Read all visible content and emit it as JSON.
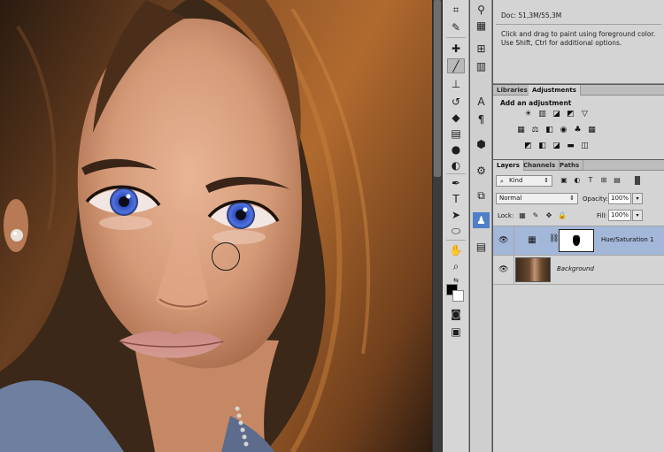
{
  "info": {
    "doc": "Doc: 51,3M/55,3M",
    "hint": "Click and drag to paint using foreground color.  Use Shift, Ctrl for additional options."
  },
  "adjustments_panel": {
    "tabs": [
      "Libraries",
      "Adjustments"
    ],
    "title": "Add an adjustment"
  },
  "layers_panel": {
    "tabs": [
      "Layers",
      "Channels",
      "Paths"
    ],
    "filter": "Kind",
    "blend_mode": "Normal",
    "opacity_label": "Opacity:",
    "opacity": "100%",
    "lock_label": "Lock:",
    "fill_label": "Fill:",
    "fill": "100%",
    "layers": [
      {
        "name": "Hue/Saturation 1",
        "selected": true
      },
      {
        "name": "Background",
        "selected": false
      }
    ]
  },
  "colors": {
    "panel_bg": "#d4d4d4",
    "selected_layer": "#a3b7d9",
    "workspace": "#535353",
    "active_tool": "#4f7fc7"
  },
  "icons": {
    "tools": [
      "crop-tool",
      "eyedropper-tool",
      "healing-brush-tool",
      "brush-tool",
      "clone-stamp-tool",
      "history-brush-tool",
      "eraser-tool",
      "gradient-tool",
      "dodge-tool",
      "pen-tool",
      "type-tool",
      "path-selection-tool",
      "ellipse-tool",
      "hand-tool",
      "zoom-tool",
      "foreground-background-colors",
      "quick-mask",
      "screen-mode"
    ],
    "strip": [
      "pin-icon",
      "grid-icon",
      "brush-settings-icon",
      "channel-icon",
      "type-icon",
      "paragraph-icon",
      "cube-icon",
      "transform-icon",
      "puppet-icon",
      "layers-icon",
      "history-icon"
    ]
  }
}
